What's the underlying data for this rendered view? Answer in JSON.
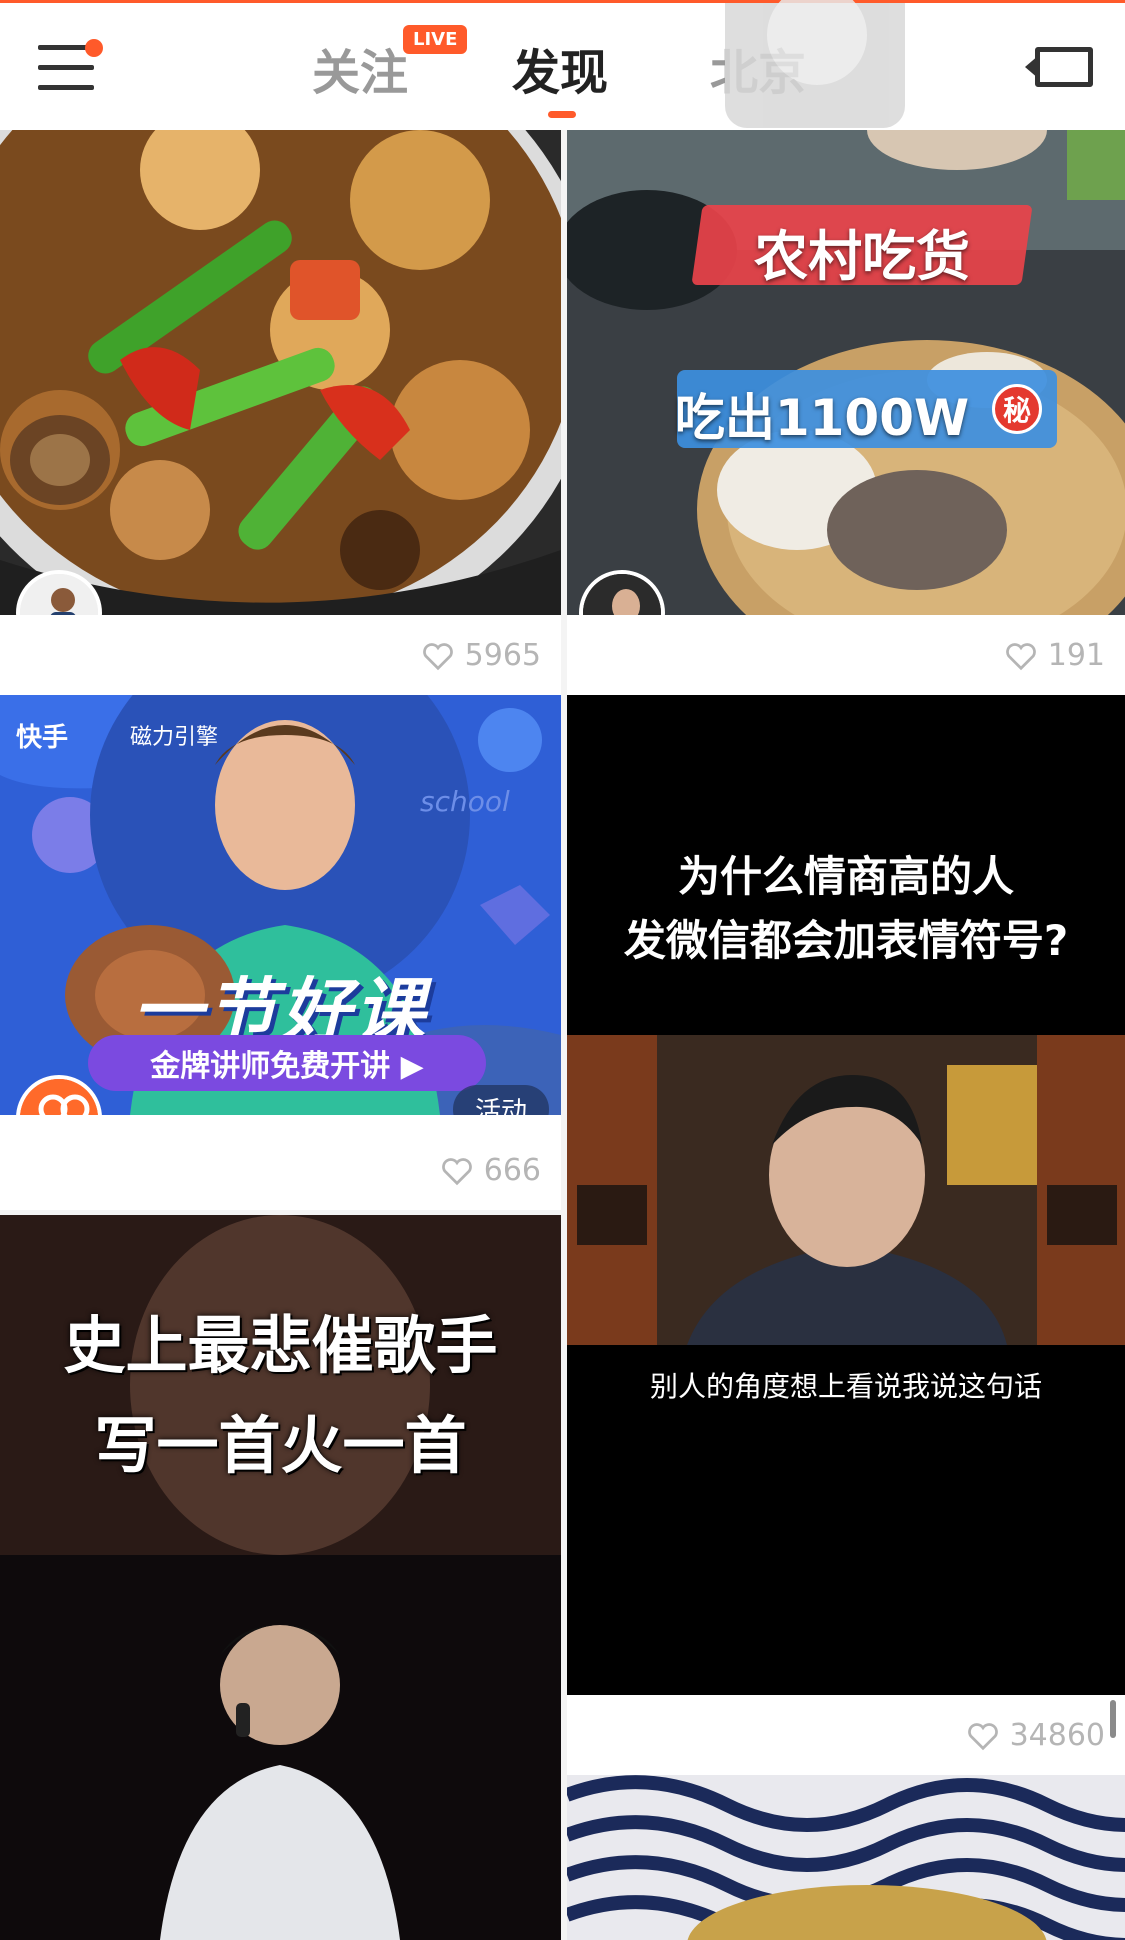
{
  "header": {
    "tabs": [
      {
        "label": "关注",
        "active": false
      },
      {
        "label": "发现",
        "active": true
      },
      {
        "label": "北京",
        "active": false
      }
    ],
    "live_badge": "LIVE",
    "menu_icon": "hamburger-menu-icon",
    "camera_icon": "video-camera-icon",
    "accent_color": "#ff5a2a"
  },
  "feed": {
    "cards": [
      {
        "id": 1,
        "likes": "5965"
      },
      {
        "id": 2,
        "overlay_line1": "农村吃货",
        "overlay_line2": "吃出1100W",
        "overlay_badge": "秘",
        "likes": "191"
      },
      {
        "id": 3,
        "brand_left": "快手",
        "brand_right": "磁力引擎",
        "headline": "一节好课",
        "cta": "金牌讲师免费开讲 ▶",
        "tag": "活动",
        "deco_text": "school",
        "likes": "666"
      },
      {
        "id": 4,
        "question_line1": "为什么情商高的人",
        "question_line2": "发微信都会加表情符号?",
        "subtitle": "别人的角度想上看说我说这句话",
        "likes": "34860"
      },
      {
        "id": 5,
        "title_line1": "史上最悲催歌手",
        "title_line2": "写一首火一首"
      },
      {
        "id": 6
      }
    ]
  }
}
